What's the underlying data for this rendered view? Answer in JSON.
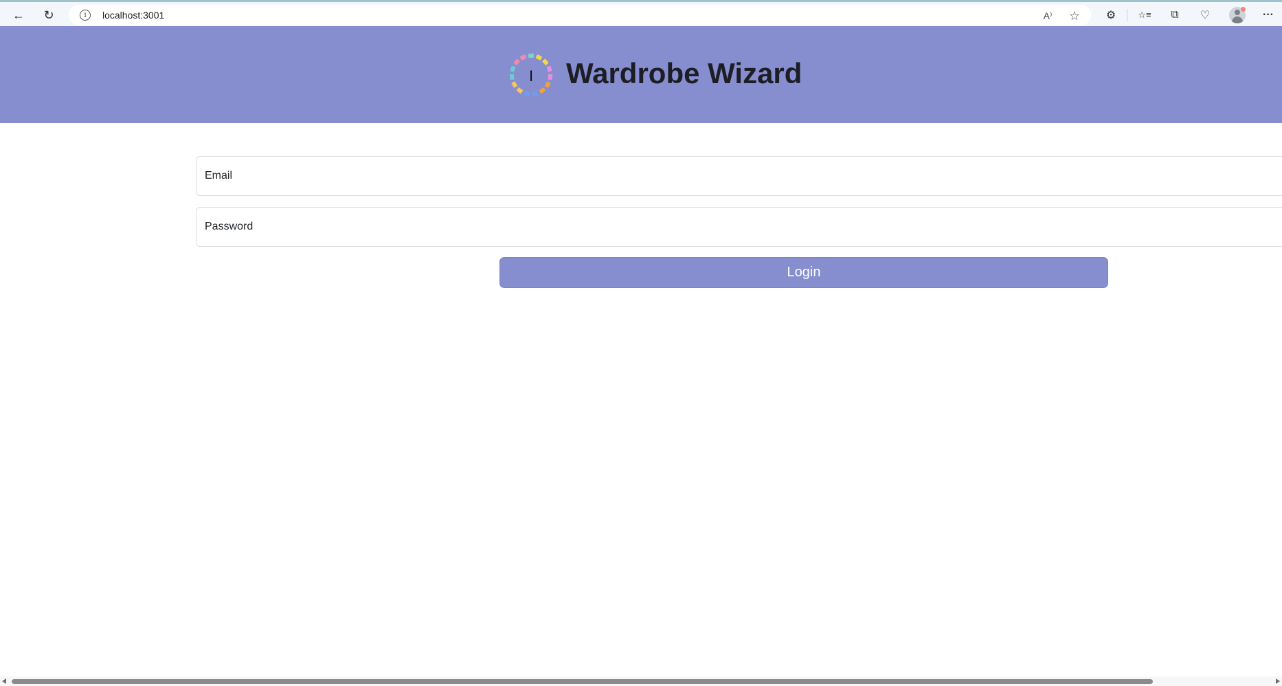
{
  "browser": {
    "url": "localhost:3001",
    "icons": {
      "back": "back-arrow-icon",
      "refresh": "refresh-icon",
      "site_info": "info-icon",
      "read_aloud": "read-aloud-icon",
      "favorite": "star-icon",
      "extensions": "puzzle-icon",
      "favorites": "favorites-icon",
      "collections": "collections-icon",
      "performance": "heart-pulse-icon",
      "profile": "profile-icon",
      "more": "more-icon"
    },
    "glyphs": {
      "back": "←",
      "refresh": "↻",
      "site_info": "i",
      "read_aloud": "A⁾",
      "favorite": "☆",
      "extensions": "⚙",
      "favorites": "☆≡",
      "collections": "⧉",
      "performance": "♡",
      "more": "···"
    }
  },
  "app": {
    "title": "Wardrobe Wizard",
    "header_color": "#868ecf",
    "logo_cursor": "I"
  },
  "form": {
    "email_placeholder": "Email",
    "email_value": "",
    "password_placeholder": "Password",
    "password_value": "",
    "login_label": "Login"
  },
  "colors": {
    "accent": "#868ecf",
    "title_text": "#1d1d25",
    "button_text": "#ffffff"
  }
}
